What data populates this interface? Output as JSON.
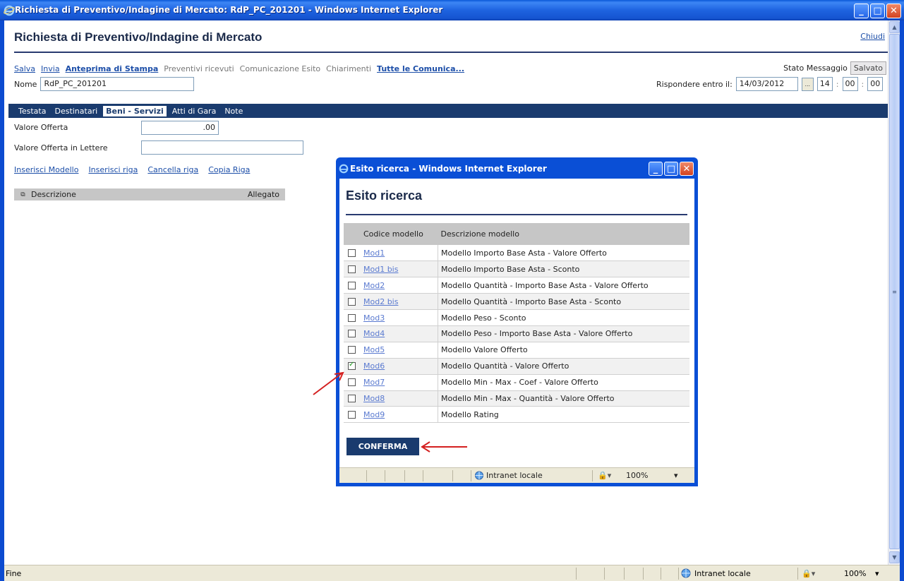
{
  "window": {
    "title": "Richiesta di Preventivo/Indagine di Mercato: RdP_PC_201201 - Windows Internet Explorer",
    "min": "_",
    "max": "□",
    "close": "✕"
  },
  "header": {
    "title": "Richiesta di Preventivo/Indagine di Mercato",
    "close_link": "Chiudi"
  },
  "toolbar": {
    "salva": "Salva",
    "invia": "Invia",
    "anteprima": "Anteprima di Stampa",
    "preventivi": "Preventivi ricevuti",
    "comunicazione": "Comunicazione Esito",
    "chiarimenti": "Chiarimenti",
    "tutte": "Tutte le Comunica..."
  },
  "stato": {
    "label": "Stato Messaggio",
    "value": "Salvato"
  },
  "nome": {
    "label": "Nome",
    "value": "RdP_PC_201201"
  },
  "risposta": {
    "label": "Rispondere entro il:",
    "date": "14/03/2012",
    "dots": "...",
    "hh": "14",
    "mm": "00",
    "ss": "00"
  },
  "tabs": [
    "Testata",
    "Destinatari",
    "Beni - Servizi",
    "Atti di Gara",
    "Note"
  ],
  "form": {
    "valore_offerta_label": "Valore Offerta",
    "valore_offerta_value": ".00",
    "valore_lettere_label": "Valore Offerta in Lettere",
    "valore_lettere_value": ""
  },
  "actions": [
    "Inserisci Modello",
    "Inserisci riga",
    "Cancella riga",
    "Copia Riga"
  ],
  "grid": {
    "col_descrizione": "Descrizione",
    "col_allegato": "Allegato"
  },
  "popup": {
    "title": "Esito ricerca - Windows Internet Explorer",
    "heading": "Esito ricerca",
    "col_codice": "Codice modello",
    "col_descrizione": "Descrizione modello",
    "rows": [
      {
        "code": "Mod1",
        "desc": "Modello Importo Base Asta - Valore Offerto",
        "checked": false
      },
      {
        "code": "Mod1 bis",
        "desc": "Modello Importo Base Asta - Sconto",
        "checked": false
      },
      {
        "code": "Mod2",
        "desc": "Modello Quantità - Importo Base Asta - Valore Offerto",
        "checked": false
      },
      {
        "code": "Mod2 bis",
        "desc": "Modello Quantità - Importo Base Asta - Sconto",
        "checked": false
      },
      {
        "code": "Mod3",
        "desc": "Modello Peso - Sconto",
        "checked": false
      },
      {
        "code": "Mod4",
        "desc": "Modello Peso - Importo Base Asta - Valore Offerto",
        "checked": false
      },
      {
        "code": "Mod5",
        "desc": "Modello Valore Offerto",
        "checked": false
      },
      {
        "code": "Mod6",
        "desc": "Modello Quantità - Valore Offerto",
        "checked": true
      },
      {
        "code": "Mod7",
        "desc": "Modello Min - Max - Coef - Valore Offerto",
        "checked": false
      },
      {
        "code": "Mod8",
        "desc": "Modello Min - Max - Quantità - Valore Offerto",
        "checked": false
      },
      {
        "code": "Mod9",
        "desc": "Modello Rating",
        "checked": false
      }
    ],
    "confirm": "CONFERMA",
    "status_zone": "Intranet locale",
    "status_zoom": "100%"
  },
  "statusbar": {
    "text": "Fine",
    "zone": "Intranet locale",
    "zoom": "100%"
  },
  "colors": {
    "ie_blue": "#1554d0",
    "tab_bar": "#1a3b6e",
    "link": "#1c4ea8",
    "annotation_red": "#d42020"
  }
}
